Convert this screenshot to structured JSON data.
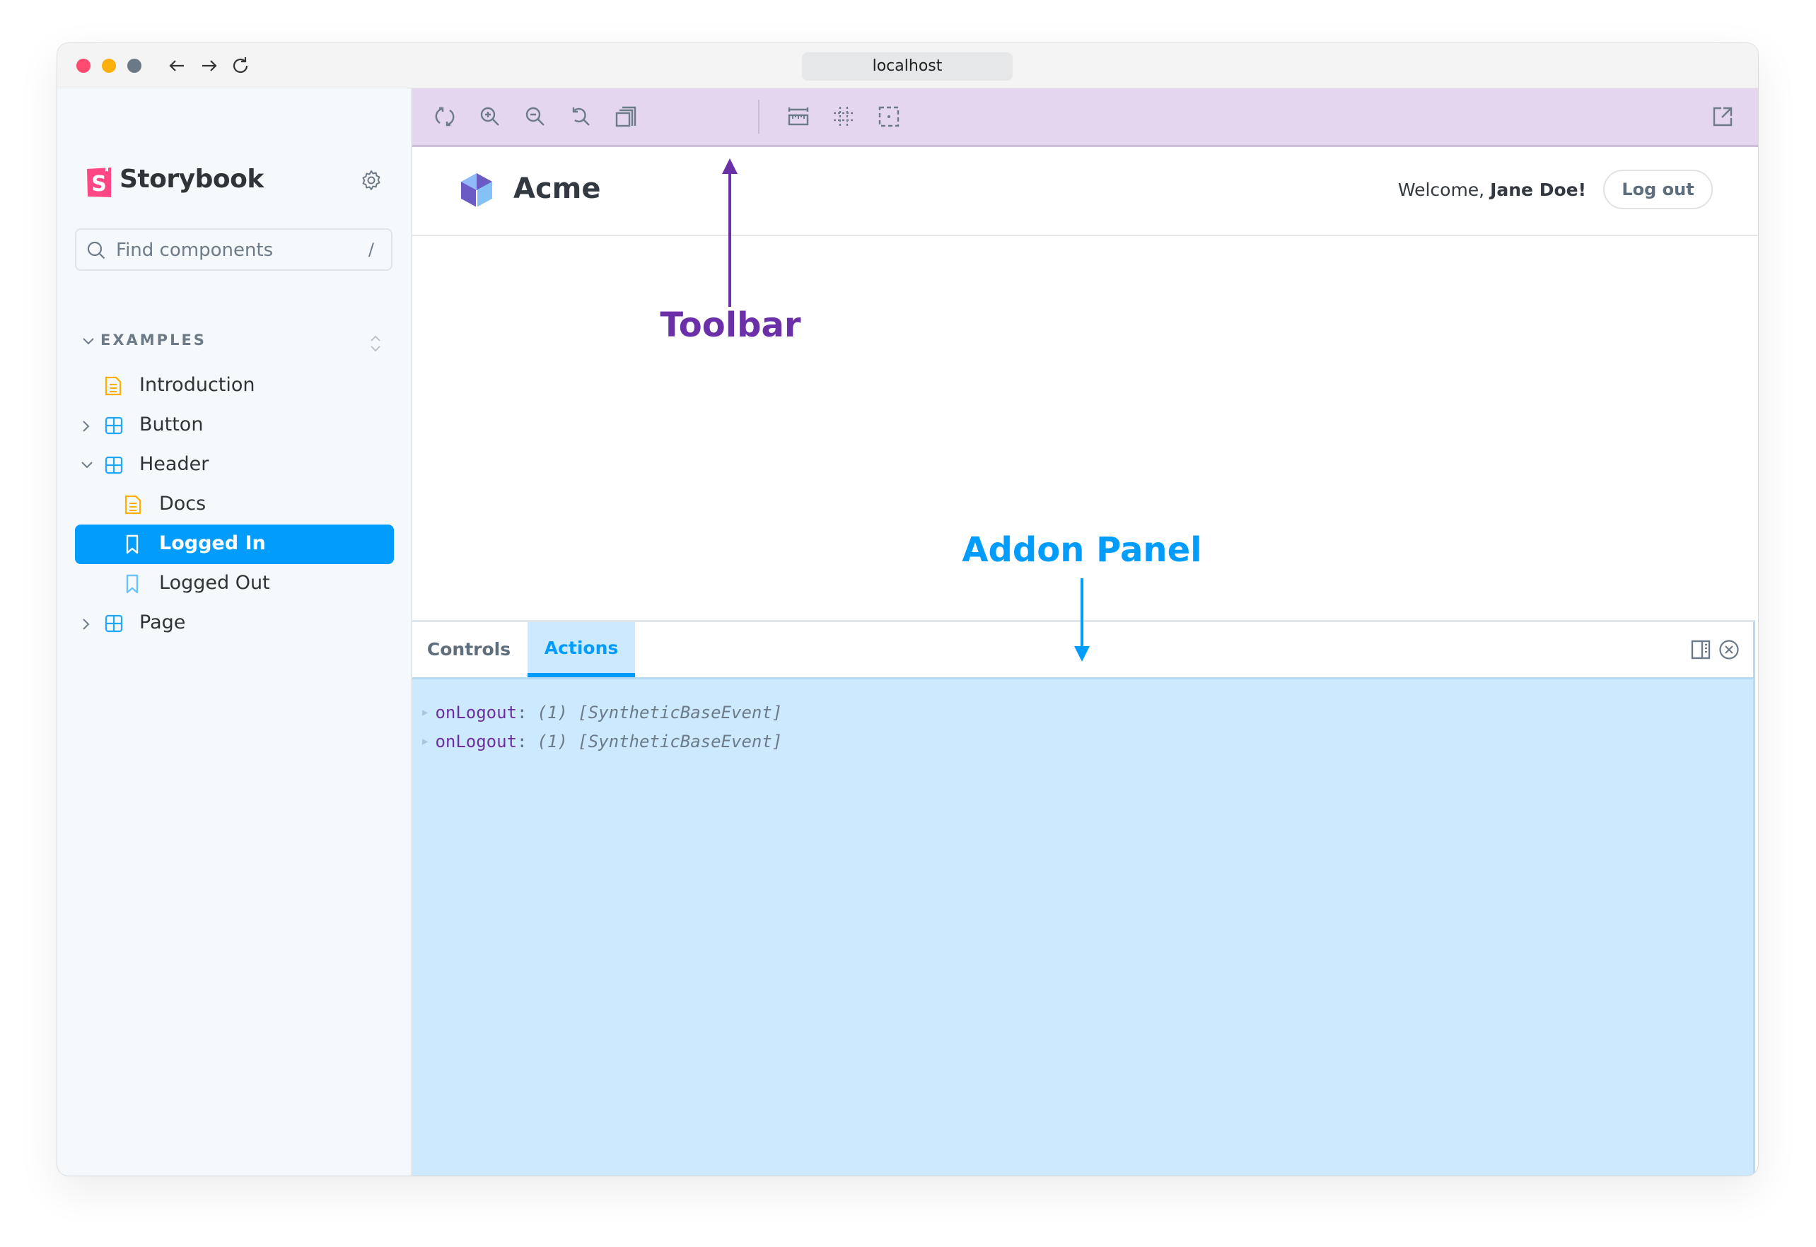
{
  "browser": {
    "url": "localhost",
    "traffic_lights": [
      "#fe4a6e",
      "#fdb00b",
      "#6b7886"
    ],
    "nav": [
      {
        "name": "back-icon",
        "glyph": "←"
      },
      {
        "name": "forward-icon",
        "glyph": "→"
      },
      {
        "name": "reload-icon",
        "glyph": "↻"
      }
    ]
  },
  "sidebar": {
    "brand": "Storybook",
    "search_placeholder": "Find components",
    "search_shortcut": "/",
    "group": "EXAMPLES",
    "items": [
      {
        "label": "Introduction",
        "type": "docs",
        "depth": 0,
        "expander": "none",
        "selected": false
      },
      {
        "label": "Button",
        "type": "component",
        "depth": 0,
        "expander": "collapsed",
        "selected": false
      },
      {
        "label": "Header",
        "type": "component",
        "depth": 0,
        "expander": "expanded",
        "selected": false
      },
      {
        "label": "Docs",
        "type": "docs",
        "depth": 1,
        "expander": "none",
        "selected": false
      },
      {
        "label": "Logged In",
        "type": "story",
        "depth": 1,
        "expander": "none",
        "selected": true
      },
      {
        "label": "Logged Out",
        "type": "story",
        "depth": 1,
        "expander": "none",
        "selected": false
      },
      {
        "label": "Page",
        "type": "component",
        "depth": 0,
        "expander": "collapsed",
        "selected": false
      }
    ]
  },
  "toolbar": {
    "buttons": [
      "remount-icon",
      "zoom-in-icon",
      "zoom-out-icon",
      "reset-zoom-icon",
      "background-icon",
      "measure-icon",
      "grid-outline-icon",
      "viewport-icon"
    ],
    "right": [
      "open-new-tab-icon"
    ]
  },
  "preview": {
    "app_name": "Acme",
    "welcome_prefix": "Welcome, ",
    "user_name": "Jane Doe!",
    "logout_label": "Log out"
  },
  "panel": {
    "tabs": [
      {
        "label": "Controls",
        "active": false
      },
      {
        "label": "Actions",
        "active": true
      }
    ],
    "logs": [
      {
        "key": "onLogout",
        "value": "(1) [SyntheticBaseEvent]"
      },
      {
        "key": "onLogout",
        "value": "(1) [SyntheticBaseEvent]"
      }
    ]
  },
  "annotations": {
    "toolbar": {
      "label": "Toolbar",
      "color": "#6b2fa8"
    },
    "addon_panel": {
      "label": "Addon Panel",
      "color": "#029cfd"
    }
  },
  "colors": {
    "accent": "#029cfd",
    "toolbar_bg": "#e3d6ee",
    "panel_bg": "#cce9fe",
    "sidebar_bg": "#f6f9fc",
    "brand": "#ff4785"
  }
}
